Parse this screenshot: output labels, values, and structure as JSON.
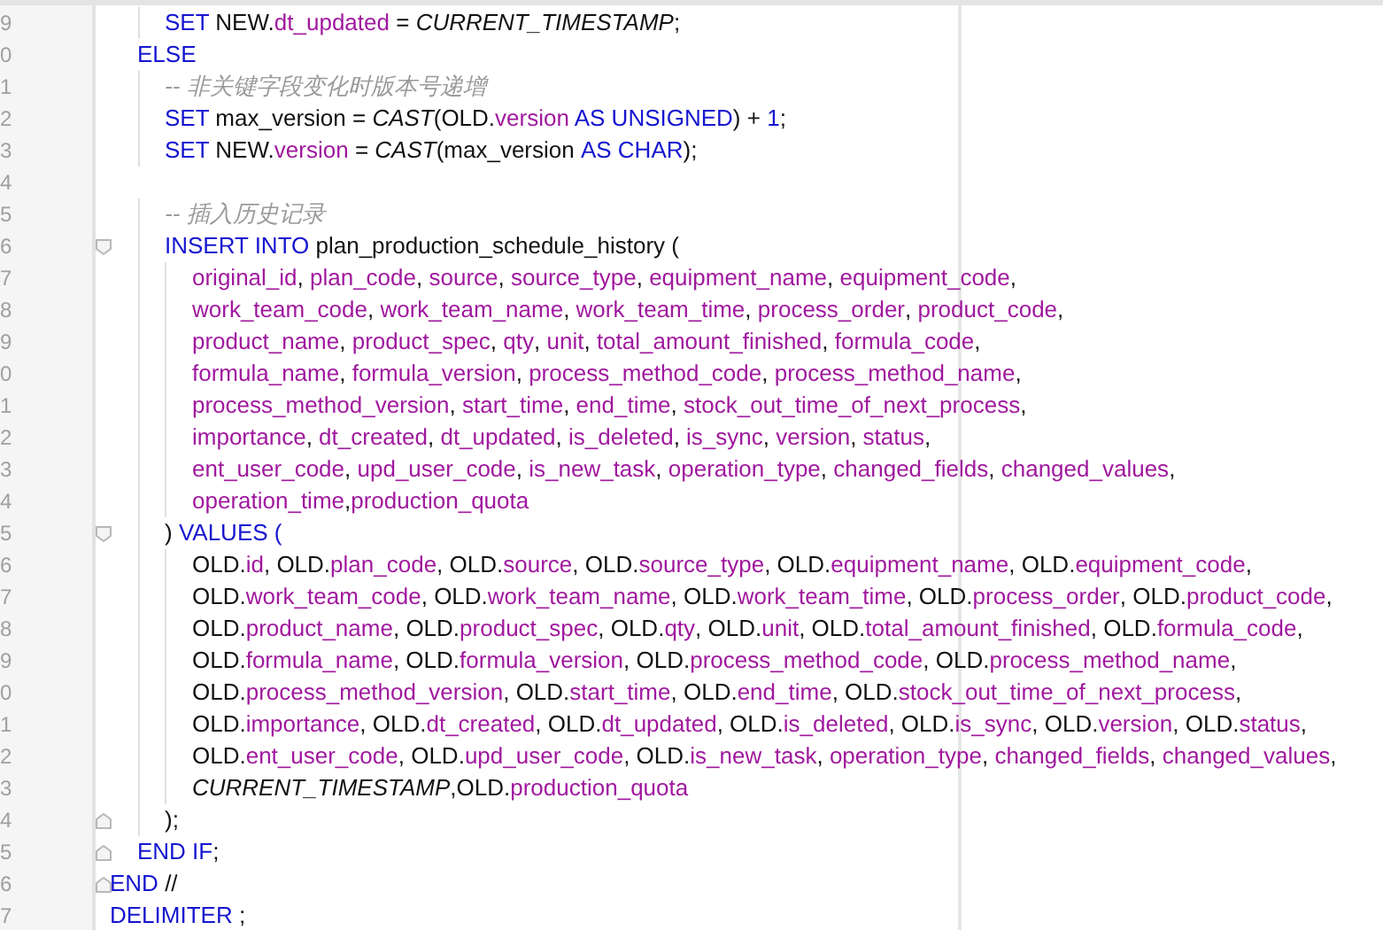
{
  "editor": {
    "lines": [
      {
        "children": [
          {
            "children": [
              {
                "number": "9",
                "tokens": [
                  {
                    "kind": "keyword",
                    "text": "SET "
                  },
                  {
                    "kind": "ident",
                    "text": "NEW."
                  },
                  {
                    "kind": "field",
                    "text": "dt_updated"
                  },
                  {
                    "kind": "ident",
                    "text": " = "
                  },
                  {
                    "kind": "func",
                    "text": "CURRENT_TIMESTAMP"
                  },
                  {
                    "kind": "ident",
                    "text": ";"
                  }
                ]
              }
            ]
          },
          {
            "number": "0",
            "tokens": [
              {
                "kind": "keyword",
                "text": "ELSE"
              }
            ],
            "children": [
              {
                "number": "1",
                "tokens": [
                  {
                    "kind": "comment",
                    "text": "-- 非关键字段变化时版本号递增"
                  }
                ]
              },
              {
                "number": "2",
                "tokens": [
                  {
                    "kind": "keyword",
                    "text": "SET "
                  },
                  {
                    "kind": "ident",
                    "text": "max_version = "
                  },
                  {
                    "kind": "func",
                    "text": "CAST"
                  },
                  {
                    "kind": "ident",
                    "text": "(OLD."
                  },
                  {
                    "kind": "field",
                    "text": "version"
                  },
                  {
                    "kind": "keyword",
                    "text": " AS UNSIGNED"
                  },
                  {
                    "kind": "ident",
                    "text": ") + "
                  },
                  {
                    "kind": "number",
                    "text": "1"
                  },
                  {
                    "kind": "ident",
                    "text": ";"
                  }
                ]
              },
              {
                "number": "3",
                "tokens": [
                  {
                    "kind": "keyword",
                    "text": "SET "
                  },
                  {
                    "kind": "ident",
                    "text": "NEW."
                  },
                  {
                    "kind": "field",
                    "text": "version"
                  },
                  {
                    "kind": "ident",
                    "text": " = "
                  },
                  {
                    "kind": "func",
                    "text": "CAST"
                  },
                  {
                    "kind": "ident",
                    "text": "(max_version "
                  },
                  {
                    "kind": "keyword",
                    "text": "AS CHAR"
                  },
                  {
                    "kind": "ident",
                    "text": ");"
                  }
                ]
              },
              {
                "number": "4"
              },
              {
                "number": "5",
                "tokens": [
                  {
                    "kind": "comment",
                    "text": "-- 插入历史记录"
                  }
                ]
              },
              {
                "number": "6",
                "kind": "opener",
                "tokens": [
                  {
                    "kind": "keyword",
                    "text": "INSERT INTO "
                  },
                  {
                    "kind": "ident",
                    "text": "plan_production_schedule_history ("
                  }
                ],
                "children": [
                  {
                    "number": "7",
                    "tokens": [
                      {
                        "kind": "field",
                        "text": "original_id",
                        "after": ", "
                      },
                      {
                        "kind": "field",
                        "text": "plan_code",
                        "after": ", "
                      },
                      {
                        "kind": "field",
                        "text": "source",
                        "after": ", "
                      },
                      {
                        "kind": "field",
                        "text": "source_type",
                        "after": ", "
                      },
                      {
                        "kind": "field",
                        "text": "equipment_name",
                        "after": ", "
                      },
                      {
                        "kind": "field",
                        "text": "equipment_code",
                        "after": ","
                      }
                    ]
                  },
                  {
                    "number": "8",
                    "tokens": [
                      {
                        "kind": "field",
                        "text": "work_team_code",
                        "after": ", "
                      },
                      {
                        "kind": "field",
                        "text": "work_team_name",
                        "after": ", "
                      },
                      {
                        "kind": "field",
                        "text": "work_team_time",
                        "after": ", "
                      },
                      {
                        "kind": "field",
                        "text": "process_order",
                        "after": ", "
                      },
                      {
                        "kind": "field",
                        "text": "product_code",
                        "after": ","
                      }
                    ]
                  },
                  {
                    "number": "9",
                    "tokens": [
                      {
                        "kind": "field",
                        "text": "product_name",
                        "after": ", "
                      },
                      {
                        "kind": "field",
                        "text": "product_spec",
                        "after": ", "
                      },
                      {
                        "kind": "field",
                        "text": "qty",
                        "after": ", "
                      },
                      {
                        "kind": "field",
                        "text": "unit",
                        "after": ", "
                      },
                      {
                        "kind": "field",
                        "text": "total_amount_finished",
                        "after": ", "
                      },
                      {
                        "kind": "field",
                        "text": "formula_code",
                        "after": ","
                      }
                    ]
                  },
                  {
                    "number": "0",
                    "tokens": [
                      {
                        "kind": "field",
                        "text": "formula_name",
                        "after": ", "
                      },
                      {
                        "kind": "field",
                        "text": "formula_version",
                        "after": ", "
                      },
                      {
                        "kind": "field",
                        "text": "process_method_code",
                        "after": ", "
                      },
                      {
                        "kind": "field",
                        "text": "process_method_name",
                        "after": ","
                      }
                    ]
                  },
                  {
                    "number": "1",
                    "tokens": [
                      {
                        "kind": "field",
                        "text": "process_method_version",
                        "after": ", "
                      },
                      {
                        "kind": "field",
                        "text": "start_time",
                        "after": ", "
                      },
                      {
                        "kind": "field",
                        "text": "end_time",
                        "after": ", "
                      },
                      {
                        "kind": "field",
                        "text": "stock_out_time_of_next_process",
                        "after": ","
                      }
                    ]
                  },
                  {
                    "number": "2",
                    "tokens": [
                      {
                        "kind": "field",
                        "text": "importance",
                        "after": ", "
                      },
                      {
                        "kind": "field",
                        "text": "dt_created",
                        "after": ", "
                      },
                      {
                        "kind": "field",
                        "text": "dt_updated",
                        "after": ", "
                      },
                      {
                        "kind": "field",
                        "text": "is_deleted",
                        "after": ", "
                      },
                      {
                        "kind": "field",
                        "text": "is_sync",
                        "after": ", "
                      },
                      {
                        "kind": "field",
                        "text": "version",
                        "after": ", "
                      },
                      {
                        "kind": "field",
                        "text": "status",
                        "after": ","
                      }
                    ]
                  },
                  {
                    "number": "3",
                    "tokens": [
                      {
                        "kind": "field",
                        "text": "ent_user_code",
                        "after": ", "
                      },
                      {
                        "kind": "field",
                        "text": "upd_user_code",
                        "after": ", "
                      },
                      {
                        "kind": "field",
                        "text": "is_new_task",
                        "after": ", "
                      },
                      {
                        "kind": "field",
                        "text": "operation_type",
                        "after": ", "
                      },
                      {
                        "kind": "field",
                        "text": "changed_fields",
                        "after": ", "
                      },
                      {
                        "kind": "field",
                        "text": "changed_values",
                        "after": ","
                      }
                    ]
                  },
                  {
                    "number": "4",
                    "tokens": [
                      {
                        "kind": "field",
                        "text": "operation_time",
                        "after": ","
                      },
                      {
                        "kind": "field",
                        "text": "production_quota"
                      }
                    ]
                  }
                ]
              },
              {
                "number": "5",
                "kind": "opener",
                "tokens": [
                  {
                    "kind": "ident",
                    "text": ") "
                  },
                  {
                    "kind": "keyword",
                    "text": "VALUES ("
                  }
                ],
                "children": [
                  {
                    "number": "6",
                    "tokens": [
                      {
                        "kind": "ident",
                        "text": "OLD."
                      },
                      {
                        "kind": "field",
                        "text": "id"
                      },
                      {
                        "kind": "ident",
                        "text": ", OLD."
                      },
                      {
                        "kind": "field",
                        "text": "plan_code"
                      },
                      {
                        "kind": "ident",
                        "text": ", OLD."
                      },
                      {
                        "kind": "field",
                        "text": "source"
                      },
                      {
                        "kind": "ident",
                        "text": ", OLD."
                      },
                      {
                        "kind": "field",
                        "text": "source_type"
                      },
                      {
                        "kind": "ident",
                        "text": ", OLD."
                      },
                      {
                        "kind": "field",
                        "text": "equipment_name"
                      },
                      {
                        "kind": "ident",
                        "text": ", OLD."
                      },
                      {
                        "kind": "field",
                        "text": "equipment_code"
                      },
                      {
                        "kind": "ident",
                        "text": ","
                      }
                    ]
                  },
                  {
                    "number": "7",
                    "tokens": [
                      {
                        "kind": "ident",
                        "text": "OLD."
                      },
                      {
                        "kind": "field",
                        "text": "work_team_code"
                      },
                      {
                        "kind": "ident",
                        "text": ", OLD."
                      },
                      {
                        "kind": "field",
                        "text": "work_team_name"
                      },
                      {
                        "kind": "ident",
                        "text": ", OLD."
                      },
                      {
                        "kind": "field",
                        "text": "work_team_time"
                      },
                      {
                        "kind": "ident",
                        "text": ", OLD."
                      },
                      {
                        "kind": "field",
                        "text": "process_order"
                      },
                      {
                        "kind": "ident",
                        "text": ", OLD."
                      },
                      {
                        "kind": "field",
                        "text": "product_code"
                      },
                      {
                        "kind": "ident",
                        "text": ","
                      }
                    ]
                  },
                  {
                    "number": "8",
                    "tokens": [
                      {
                        "kind": "ident",
                        "text": "OLD."
                      },
                      {
                        "kind": "field",
                        "text": "product_name"
                      },
                      {
                        "kind": "ident",
                        "text": ", OLD."
                      },
                      {
                        "kind": "field",
                        "text": "product_spec"
                      },
                      {
                        "kind": "ident",
                        "text": ", OLD."
                      },
                      {
                        "kind": "field",
                        "text": "qty"
                      },
                      {
                        "kind": "ident",
                        "text": ", OLD."
                      },
                      {
                        "kind": "field",
                        "text": "unit"
                      },
                      {
                        "kind": "ident",
                        "text": ", OLD."
                      },
                      {
                        "kind": "field",
                        "text": "total_amount_finished"
                      },
                      {
                        "kind": "ident",
                        "text": ", OLD."
                      },
                      {
                        "kind": "field",
                        "text": "formula_code"
                      },
                      {
                        "kind": "ident",
                        "text": ","
                      }
                    ]
                  },
                  {
                    "number": "9",
                    "tokens": [
                      {
                        "kind": "ident",
                        "text": "OLD."
                      },
                      {
                        "kind": "field",
                        "text": "formula_name"
                      },
                      {
                        "kind": "ident",
                        "text": ", OLD."
                      },
                      {
                        "kind": "field",
                        "text": "formula_version"
                      },
                      {
                        "kind": "ident",
                        "text": ", OLD."
                      },
                      {
                        "kind": "field",
                        "text": "process_method_code"
                      },
                      {
                        "kind": "ident",
                        "text": ", OLD."
                      },
                      {
                        "kind": "field",
                        "text": "process_method_name"
                      },
                      {
                        "kind": "ident",
                        "text": ","
                      }
                    ]
                  },
                  {
                    "number": "0",
                    "tokens": [
                      {
                        "kind": "ident",
                        "text": "OLD."
                      },
                      {
                        "kind": "field",
                        "text": "process_method_version"
                      },
                      {
                        "kind": "ident",
                        "text": ", OLD."
                      },
                      {
                        "kind": "field",
                        "text": "start_time"
                      },
                      {
                        "kind": "ident",
                        "text": ", OLD."
                      },
                      {
                        "kind": "field",
                        "text": "end_time"
                      },
                      {
                        "kind": "ident",
                        "text": ", OLD."
                      },
                      {
                        "kind": "field",
                        "text": "stock_out_time_of_next_process"
                      },
                      {
                        "kind": "ident",
                        "text": ","
                      }
                    ]
                  },
                  {
                    "number": "1",
                    "tokens": [
                      {
                        "kind": "ident",
                        "text": "OLD."
                      },
                      {
                        "kind": "field",
                        "text": "importance"
                      },
                      {
                        "kind": "ident",
                        "text": ", OLD."
                      },
                      {
                        "kind": "field",
                        "text": "dt_created"
                      },
                      {
                        "kind": "ident",
                        "text": ", OLD."
                      },
                      {
                        "kind": "field",
                        "text": "dt_updated"
                      },
                      {
                        "kind": "ident",
                        "text": ", OLD."
                      },
                      {
                        "kind": "field",
                        "text": "is_deleted"
                      },
                      {
                        "kind": "ident",
                        "text": ", OLD."
                      },
                      {
                        "kind": "field",
                        "text": "is_sync"
                      },
                      {
                        "kind": "ident",
                        "text": ", OLD."
                      },
                      {
                        "kind": "field",
                        "text": "version"
                      },
                      {
                        "kind": "ident",
                        "text": ", OLD."
                      },
                      {
                        "kind": "field",
                        "text": "status"
                      },
                      {
                        "kind": "ident",
                        "text": ","
                      }
                    ]
                  },
                  {
                    "number": "2",
                    "tokens": [
                      {
                        "kind": "ident",
                        "text": "OLD."
                      },
                      {
                        "kind": "field",
                        "text": "ent_user_code"
                      },
                      {
                        "kind": "ident",
                        "text": ", OLD."
                      },
                      {
                        "kind": "field",
                        "text": "upd_user_code"
                      },
                      {
                        "kind": "ident",
                        "text": ", OLD."
                      },
                      {
                        "kind": "field",
                        "text": "is_new_task",
                        "after": ", "
                      },
                      {
                        "kind": "field",
                        "text": "operation_type",
                        "after": ", "
                      },
                      {
                        "kind": "field",
                        "text": "changed_fields",
                        "after": ", "
                      },
                      {
                        "kind": "field",
                        "text": "changed_values",
                        "after": ","
                      }
                    ]
                  },
                  {
                    "number": "3",
                    "tokens": [
                      {
                        "kind": "func",
                        "text": "CURRENT_TIMESTAMP"
                      },
                      {
                        "kind": "ident",
                        "text": ",OLD."
                      },
                      {
                        "kind": "field",
                        "text": "production_quota"
                      }
                    ]
                  }
                ]
              },
              {
                "number": "4",
                "kind": "closer",
                "tokens": [
                  {
                    "kind": "ident",
                    "text": ");"
                  }
                ]
              }
            ]
          },
          {
            "number": "5",
            "kind": "closer",
            "tokens": [
              {
                "kind": "keyword",
                "text": "END IF"
              },
              {
                "kind": "ident",
                "text": ";"
              }
            ]
          }
        ]
      },
      {
        "number": "6",
        "kind": "closer",
        "tokens": [
          {
            "kind": "keyword",
            "text": "END"
          },
          {
            "kind": "ident",
            "text": " //"
          }
        ]
      },
      {
        "number": "7",
        "tokens": [
          {
            "kind": "keyword",
            "text": "DELIMITER"
          },
          {
            "kind": "ident",
            "text": " ;"
          }
        ]
      }
    ]
  }
}
